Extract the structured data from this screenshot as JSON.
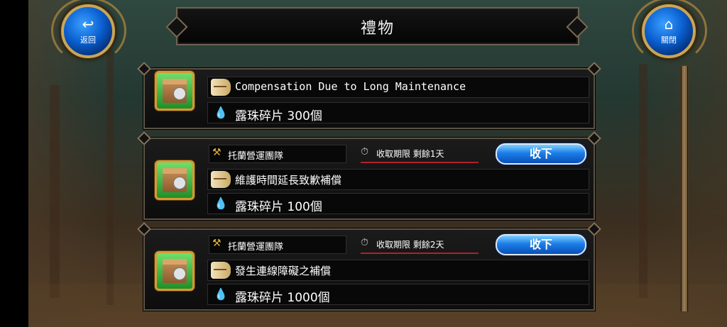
{
  "header": {
    "title": "禮物"
  },
  "buttons": {
    "back": {
      "label": "返回",
      "icon": "return-arrow-icon"
    },
    "close": {
      "label": "關閉",
      "icon": "home-icon"
    }
  },
  "gifts": [
    {
      "title": "Compensation Due to Long Maintenance",
      "reward": "露珠碎片  300個"
    },
    {
      "sender": "托蘭營運團隊",
      "expire": "收取期限  剩餘1天",
      "claim_label": "收下",
      "title": "維護時間延長致歉補償",
      "reward": "露珠碎片  100個"
    },
    {
      "sender": "托蘭營運團隊",
      "expire": "收取期限  剩餘2天",
      "claim_label": "收下",
      "title": "發生連線障礙之補償",
      "reward": "露珠碎片  1000個"
    }
  ],
  "colors": {
    "claim_button": "#1c7ee8",
    "frame_gold": "#c8a659",
    "expire_line": "#b0202a"
  }
}
